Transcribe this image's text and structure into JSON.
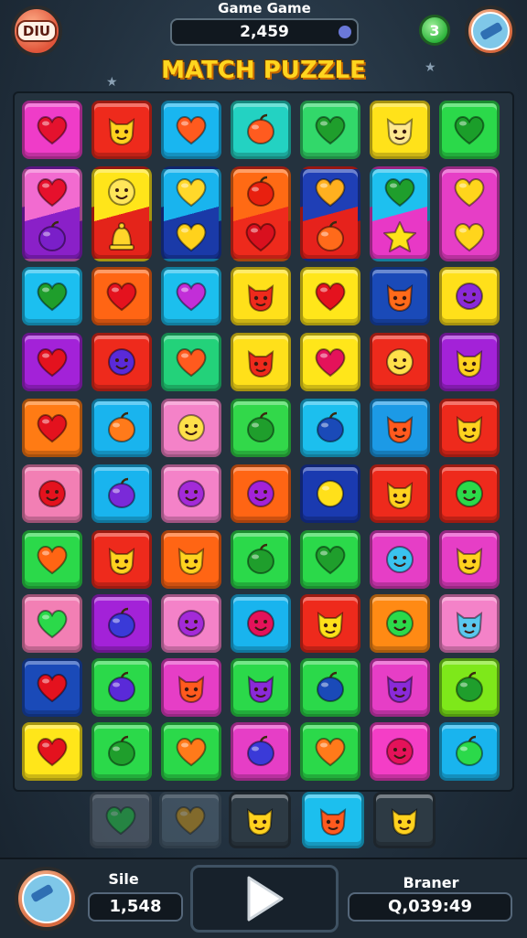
{
  "header": {
    "menu_label": "DIU",
    "game_label": "Game Game",
    "score": "2,459",
    "badge_label": "3",
    "title": "MATCH PUZZLE"
  },
  "board": {
    "rows": [
      [
        {
          "bg": "#ef3cc8",
          "shape": "heart",
          "color": "#e4122e"
        },
        {
          "bg": "#ee2a1c",
          "shape": "cat",
          "color": "#ffd21f"
        },
        {
          "bg": "#19b6f0",
          "shape": "heart",
          "color": "#ff5a1e"
        },
        {
          "bg": "#23d2c2",
          "shape": "fruit",
          "color": "#ff5b1f"
        },
        {
          "bg": "#32d86a",
          "shape": "heart",
          "color": "#1f9e2c"
        },
        {
          "bg": "#ffe21a",
          "shape": "cat",
          "color": "#ffe88f"
        },
        {
          "bg": "#2bd94a",
          "shape": "heart",
          "color": "#1b9e2a"
        }
      ],
      [
        {
          "bg": "#f26bd0",
          "bg2": "#8a20c8",
          "shape": "heart",
          "color": "#e6102c",
          "shape2": "fruit",
          "color2": "#7a1fc9"
        },
        {
          "bg": "#ffe51a",
          "bg2": "#e4241a",
          "shape": "smile",
          "color": "#ffe65a",
          "shape2": "bell",
          "color2": "#ffd52a"
        },
        {
          "bg": "#19b4ee",
          "bg2": "#1a3aa8",
          "shape": "heart",
          "color": "#ffd82a",
          "shape2": "heart",
          "color2": "#ffd21c"
        },
        {
          "bg": "#ff6a14",
          "bg2": "#ee2a1c",
          "shape": "fruit",
          "color": "#e8200f",
          "shape2": "heart",
          "color2": "#d9101e"
        },
        {
          "bg": "#1f3fb6",
          "bg2": "#e6221c",
          "shape": "heart",
          "color": "#ffb01f",
          "shape2": "fruit",
          "color2": "#ff6a1a"
        },
        {
          "bg": "#1ec0ef",
          "bg2": "#e838c6",
          "shape": "heart",
          "color": "#1f9e2c",
          "shape2": "star",
          "color2": "#ffe21a"
        },
        {
          "bg": "#e63ec6",
          "bg2": "#e63ec6",
          "shape": "heart",
          "color": "#ffd51c",
          "shape2": "heart",
          "color2": "#ffd51c"
        }
      ],
      [
        {
          "bg": "#1cbff0",
          "shape": "heart",
          "color": "#1f9e2c"
        },
        {
          "bg": "#ff6514",
          "shape": "heart",
          "color": "#e4121e"
        },
        {
          "bg": "#1cbfee",
          "shape": "heart",
          "color": "#c22ed8"
        },
        {
          "bg": "#ffe01a",
          "shape": "cat",
          "color": "#ee2a1c"
        },
        {
          "bg": "#ffe61a",
          "shape": "heart",
          "color": "#e4121e"
        },
        {
          "bg": "#1a4ab8",
          "shape": "cat",
          "color": "#ff6a1a"
        },
        {
          "bg": "#ffe01a",
          "shape": "face",
          "color": "#8a2ad8"
        }
      ],
      [
        {
          "bg": "#a322d8",
          "shape": "heart",
          "color": "#e4121e"
        },
        {
          "bg": "#ee2a1c",
          "shape": "face",
          "color": "#5a2ad8"
        },
        {
          "bg": "#23d27a",
          "shape": "heart",
          "color": "#ff5a1e"
        },
        {
          "bg": "#ffe01a",
          "shape": "cat",
          "color": "#ee2a1c"
        },
        {
          "bg": "#ffe61a",
          "shape": "heart",
          "color": "#e4125a"
        },
        {
          "bg": "#ee2a1c",
          "shape": "smile",
          "color": "#ffe04a"
        },
        {
          "bg": "#a322d8",
          "shape": "cat",
          "color": "#ffd21f"
        }
      ],
      [
        {
          "bg": "#ff7b14",
          "shape": "heart",
          "color": "#e4121e"
        },
        {
          "bg": "#19b4ee",
          "shape": "fruit",
          "color": "#ff7a1a"
        },
        {
          "bg": "#f482c8",
          "shape": "smile",
          "color": "#ffe04a"
        },
        {
          "bg": "#32d84a",
          "shape": "fruit",
          "color": "#1f9e2c"
        },
        {
          "bg": "#1cbfee",
          "shape": "fruit",
          "color": "#1a4ab8"
        },
        {
          "bg": "#1c9ae6",
          "shape": "cat",
          "color": "#ff5a1e"
        },
        {
          "bg": "#ee2a1c",
          "shape": "cat",
          "color": "#ffd21f"
        }
      ],
      [
        {
          "bg": "#f27fb4",
          "shape": "face",
          "color": "#e4121e"
        },
        {
          "bg": "#19b4ee",
          "shape": "fruit",
          "color": "#7a2ad8"
        },
        {
          "bg": "#f482c8",
          "shape": "face",
          "color": "#a32ad8"
        },
        {
          "bg": "#ff6514",
          "shape": "face",
          "color": "#a322d8"
        },
        {
          "bg": "#1a3ab0",
          "shape": "circle",
          "color": "#ffe01a"
        },
        {
          "bg": "#ee2a1c",
          "shape": "cat",
          "color": "#ffd21f"
        },
        {
          "bg": "#ee2a1c",
          "shape": "smile",
          "color": "#2bd94a"
        }
      ],
      [
        {
          "bg": "#2bd94a",
          "shape": "heart",
          "color": "#ff6514"
        },
        {
          "bg": "#ee2a1c",
          "shape": "cat",
          "color": "#ffd21f"
        },
        {
          "bg": "#ff6514",
          "shape": "cat",
          "color": "#ffd21f"
        },
        {
          "bg": "#2bd94a",
          "shape": "fruit",
          "color": "#1f9e2c"
        },
        {
          "bg": "#2bd94a",
          "shape": "heart",
          "color": "#1f9e2c"
        },
        {
          "bg": "#e63ec6",
          "shape": "face",
          "color": "#3ac2ee"
        },
        {
          "bg": "#e63ec6",
          "shape": "cat",
          "color": "#ffd21f"
        }
      ],
      [
        {
          "bg": "#f27fb4",
          "shape": "heart",
          "color": "#2bd94a"
        },
        {
          "bg": "#a322d8",
          "shape": "fruit",
          "color": "#3a3ad8"
        },
        {
          "bg": "#f482c8",
          "shape": "face",
          "color": "#a32ad8"
        },
        {
          "bg": "#19b4ee",
          "shape": "face",
          "color": "#e4125a"
        },
        {
          "bg": "#ee2a1c",
          "shape": "cat",
          "color": "#ffe01a"
        },
        {
          "bg": "#ff8a14",
          "shape": "smile",
          "color": "#2bd94a"
        },
        {
          "bg": "#f482c8",
          "shape": "cat",
          "color": "#5ac8ee"
        }
      ],
      [
        {
          "bg": "#1a4ab8",
          "shape": "heart",
          "color": "#e4121e"
        },
        {
          "bg": "#2bd94a",
          "shape": "fruit",
          "color": "#5a2ad8"
        },
        {
          "bg": "#e63ec6",
          "shape": "cat",
          "color": "#ff5a1e"
        },
        {
          "bg": "#2bd94a",
          "shape": "cat",
          "color": "#8a2ad8"
        },
        {
          "bg": "#2bd94a",
          "shape": "fruit",
          "color": "#1a4ab8"
        },
        {
          "bg": "#e63ec6",
          "shape": "cat",
          "color": "#8a2ad8"
        },
        {
          "bg": "#7ee81a",
          "shape": "fruit",
          "color": "#1f9e2c"
        }
      ],
      [
        {
          "bg": "#ffe61a",
          "shape": "heart",
          "color": "#e4121e"
        },
        {
          "bg": "#2bd94a",
          "shape": "fruit",
          "color": "#1f9e2c"
        },
        {
          "bg": "#2bd94a",
          "shape": "heart",
          "color": "#ff7a1a"
        },
        {
          "bg": "#e63ec6",
          "shape": "fruit",
          "color": "#3a3ad8"
        },
        {
          "bg": "#2bd94a",
          "shape": "heart",
          "color": "#ff7a1a"
        },
        {
          "bg": "#f43ec6",
          "shape": "face",
          "color": "#e4125a"
        },
        {
          "bg": "#19b4ee",
          "shape": "fruit",
          "color": "#2bd94a"
        }
      ]
    ],
    "queue": [
      {
        "bg": "#6a7380",
        "shape": "heart",
        "color": "#2bd94a",
        "faded": true
      },
      {
        "bg": "#5c7080",
        "shape": "heart",
        "color": "#e0a31a",
        "faded": true
      },
      {
        "bg": "#2d3a44",
        "shape": "cat",
        "color": "#ffd21f",
        "faded": false
      },
      {
        "bg": "#1cbfee",
        "shape": "cat",
        "color": "#ff5a1e",
        "faded": false
      },
      {
        "bg": "#2d3a44",
        "shape": "cat",
        "color": "#ffd21f",
        "faded": false
      }
    ]
  },
  "footer": {
    "left_label": "Sile",
    "left_value": "1,548",
    "right_label": "Braner",
    "right_value": "Q,039:49"
  }
}
